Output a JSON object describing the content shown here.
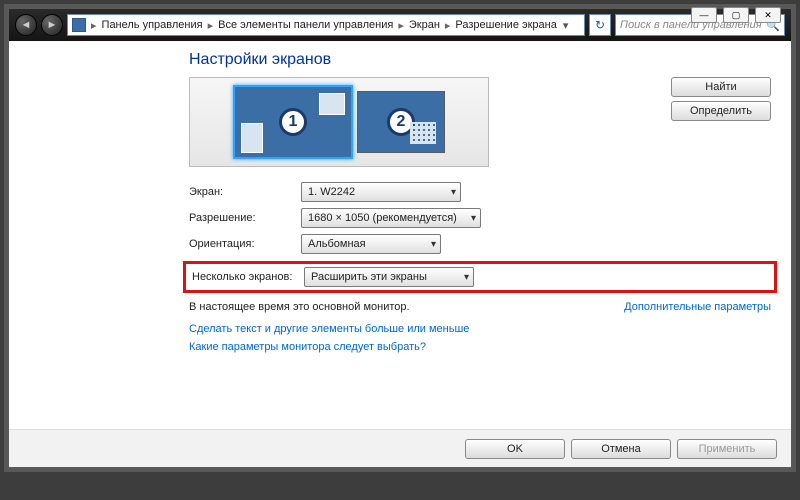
{
  "titlebar": {
    "min": "—",
    "max": "▢",
    "close": "✕"
  },
  "nav": {
    "back": "◄",
    "fwd": "►"
  },
  "breadcrumbs": {
    "items": [
      "Панель управления",
      "Все элементы панели управления",
      "Экран",
      "Разрешение экрана"
    ],
    "sep": "▸"
  },
  "refresh_icon": "↻",
  "search": {
    "placeholder": "Поиск в панели управления",
    "icon": "🔍"
  },
  "heading": "Настройки экранов",
  "monitors": {
    "m1": "1",
    "m2": "2"
  },
  "side_buttons": {
    "find": "Найти",
    "identify": "Определить"
  },
  "form": {
    "screen_label": "Экран:",
    "screen_value": "1. W2242",
    "resolution_label": "Разрешение:",
    "resolution_value": "1680 × 1050 (рекомендуется)",
    "orientation_label": "Ориентация:",
    "orientation_value": "Альбомная",
    "multi_label": "Несколько экранов:",
    "multi_value": "Расширить эти экраны"
  },
  "note_text": "В настоящее время это основной монитор.",
  "adv_link": "Дополнительные параметры",
  "link1": "Сделать текст и другие элементы больше или меньше",
  "link2": "Какие параметры монитора следует выбрать?",
  "footer": {
    "ok": "OK",
    "cancel": "Отмена",
    "apply": "Применить"
  }
}
